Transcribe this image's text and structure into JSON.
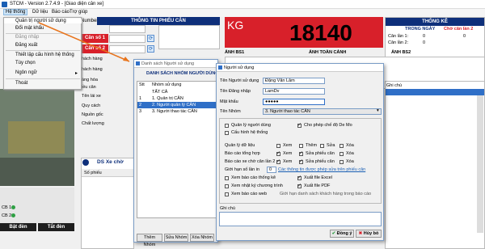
{
  "app": {
    "title": "STCM - Version 2.7.4.9 - [Giao diện cân xe]"
  },
  "menu": {
    "items": [
      "Hệ thống",
      "Dữ liệu",
      "Báo cáo",
      "Trợ giúp"
    ]
  },
  "system_menu": {
    "items": [
      "Quản trị người sử dụng",
      "Đổi mật khẩu",
      "Đăng nhập",
      "Đăng xuất",
      "Thiết lập cấu hình hệ thống",
      "Tùy chọn",
      "Ngôn ngữ",
      "Thoát"
    ]
  },
  "main": {
    "number_label": "Number",
    "ticket_header": "THÔNG TIN PHIẾU CÂN",
    "scale1": "Cân số 1",
    "scale2": "Cân số 2",
    "kg_unit": "KG",
    "weight": "18140",
    "side_labels": [
      "hách hàng",
      "hách hàng",
      "àng hóa",
      "iều cân",
      "Tên lái xe",
      "Quy cách",
      "Nguồn gốc",
      "Chất lượng"
    ],
    "img_bs1": "ẢNH BS1",
    "img_full": "ẢNH TOÀN CẢNH",
    "img_bs2": "ẢNH BS2",
    "waiting_title": "DS Xe chờ",
    "ticket_no_col": "Số phiếu",
    "note_col": "Ghi chú",
    "cb1": "CB 1",
    "cb2": "CB 2",
    "btn_on": "Bật đèn",
    "btn_off": "Tắt đèn"
  },
  "stats": {
    "title": "THỐNG KÊ",
    "col1": "TRONG NGÀY",
    "col2": "Chờ cân lần 2",
    "row1": "Cân lần 1:",
    "row2": "Cân lần 2:",
    "v1": "0",
    "v2": "0",
    "v3": "0"
  },
  "group_dialog": {
    "title": "Danh sách Người sử dụng",
    "heading": "DANH SÁCH NHÓM NGƯỜI DÙNG",
    "col_stt": "Stt",
    "col_name": "Nhóm sử dụng",
    "rows": [
      {
        "stt": "",
        "name": "TẤT CẢ"
      },
      {
        "stt": "1",
        "name": "1. Quản trị CÂN"
      },
      {
        "stt": "2",
        "name": "2. Người quản lý CÂN"
      },
      {
        "stt": "3",
        "name": "3. Người thao tác CÂN"
      }
    ],
    "btn_add": "Thêm Nhóm",
    "btn_edit": "Sửa Nhóm",
    "btn_del": "Xóa Nhóm"
  },
  "user_dialog": {
    "title": "Người sử dụng",
    "fullname_label": "Tên Người sử dụng",
    "fullname": "Đặng Văn Lâm",
    "login_label": "Tên Đăng nhập",
    "login": "LamDv",
    "password_label": "Mật khẩu",
    "password": "●●●●●",
    "group_label": "Tên Nhóm",
    "group": "3. Người thao tác CÂN",
    "perm_user_mgmt": "Quản lý người dùng",
    "perm_debug": "Cho phép chế độ De Mo",
    "perm_config": "Cấu hình hệ thống",
    "perm_data": "Quản lý dữ liệu",
    "perm_summary": "Báo cáo tổng hợp",
    "perm_waiting": "Báo cáo xe chờ cân lần 2",
    "view": "Xem",
    "add": "Thêm",
    "edit": "Sửa",
    "delete": "Xóa",
    "edit_ticket": "Sửa phiếu cân",
    "limit_label": "Giới hạn số lần in",
    "limit_value": "0",
    "print_info_link": "Các thông tin được phép sửa trên phiếu cân",
    "stat_report": "Xem báo cáo thống kê",
    "excel": "Xuất file Excel",
    "log": "Xem nhật ký chương trình",
    "pdf": "Xuất file PDF",
    "web": "Xem báo cáo web",
    "web_note": "Giới hạn danh sách khách hàng trong báo cáo",
    "note_label": "Ghi chú",
    "ok": "Đồng ý",
    "cancel": "Hủy bỏ"
  },
  "grid": {
    "col_note": "Ghi chú"
  }
}
